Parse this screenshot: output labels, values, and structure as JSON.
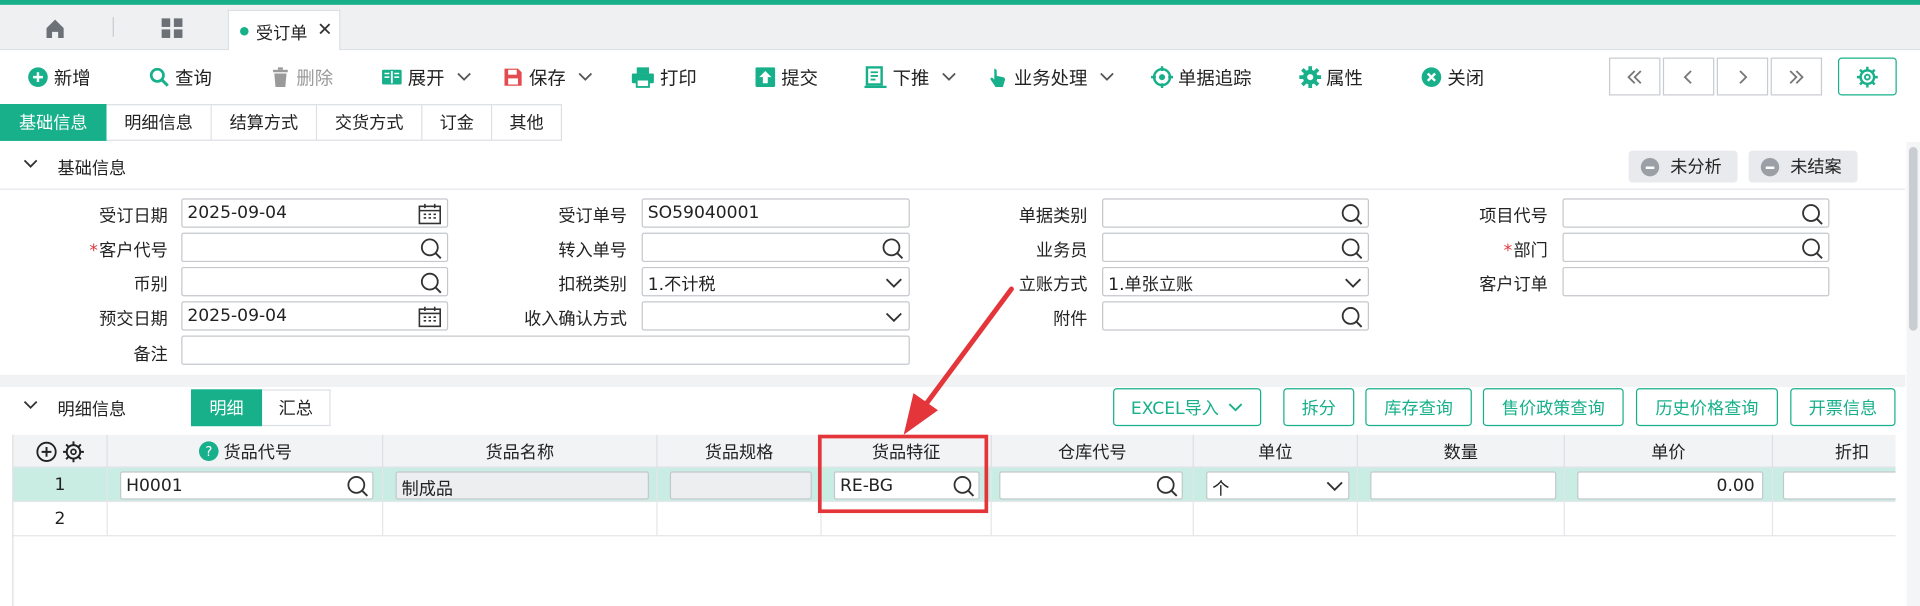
{
  "tab": {
    "title": "受订单",
    "close": "✕"
  },
  "toolbar": {
    "items": [
      {
        "label": "新增"
      },
      {
        "label": "查询"
      },
      {
        "label": "删除"
      },
      {
        "label": "展开"
      },
      {
        "label": "保存"
      },
      {
        "label": "打印"
      },
      {
        "label": "提交"
      },
      {
        "label": "下推"
      },
      {
        "label": "业务处理"
      },
      {
        "label": "单据追踪"
      },
      {
        "label": "属性"
      },
      {
        "label": "关闭"
      }
    ]
  },
  "sub_tabs": [
    "基础信息",
    "明细信息",
    "结算方式",
    "交货方式",
    "订金",
    "其他"
  ],
  "basic": {
    "title": "基础信息",
    "status": [
      "未分析",
      "未结案"
    ],
    "fields": {
      "order_date": {
        "label": "受订日期",
        "value": "2025-09-04"
      },
      "customer_code": {
        "label": "客户代号",
        "value": "",
        "required": "*"
      },
      "currency": {
        "label": "币别",
        "value": ""
      },
      "delivery_date": {
        "label": "预交日期",
        "value": "2025-09-04"
      },
      "remark": {
        "label": "备注",
        "value": ""
      },
      "order_no": {
        "label": "受订单号",
        "value": "SO59040001"
      },
      "transfer_no": {
        "label": "转入单号",
        "value": ""
      },
      "tax_type": {
        "label": "扣税类别",
        "value": "1.不计税"
      },
      "income_method": {
        "label": "收入确认方式",
        "value": ""
      },
      "doc_type": {
        "label": "单据类别",
        "value": ""
      },
      "salesman": {
        "label": "业务员",
        "value": ""
      },
      "account_method": {
        "label": "立账方式",
        "value": "1.单张立账"
      },
      "attachment": {
        "label": "附件",
        "value": ""
      },
      "project_code": {
        "label": "项目代号",
        "value": ""
      },
      "department": {
        "label": "部门",
        "value": "",
        "required": "*"
      },
      "customer_order": {
        "label": "客户订单",
        "value": ""
      }
    }
  },
  "detail": {
    "title": "明细信息",
    "seg": [
      "明细",
      "汇总"
    ],
    "buttons": [
      "EXCEL导入",
      "拆分",
      "库存查询",
      "售价政策查询",
      "历史价格查询",
      "开票信息"
    ],
    "columns": [
      "货品代号",
      "货品名称",
      "货品规格",
      "货品特征",
      "仓库代号",
      "单位",
      "数量",
      "单价",
      "折扣"
    ],
    "rows": [
      {
        "no": "1",
        "code": "H0001",
        "name": "制成品",
        "spec": "",
        "feature": "RE-BG",
        "warehouse": "",
        "unit": "个",
        "qty": "",
        "price": "0.00"
      },
      {
        "no": "2"
      }
    ]
  },
  "colors": {
    "accent": "#17b08a",
    "highlight": "#e4353a"
  }
}
